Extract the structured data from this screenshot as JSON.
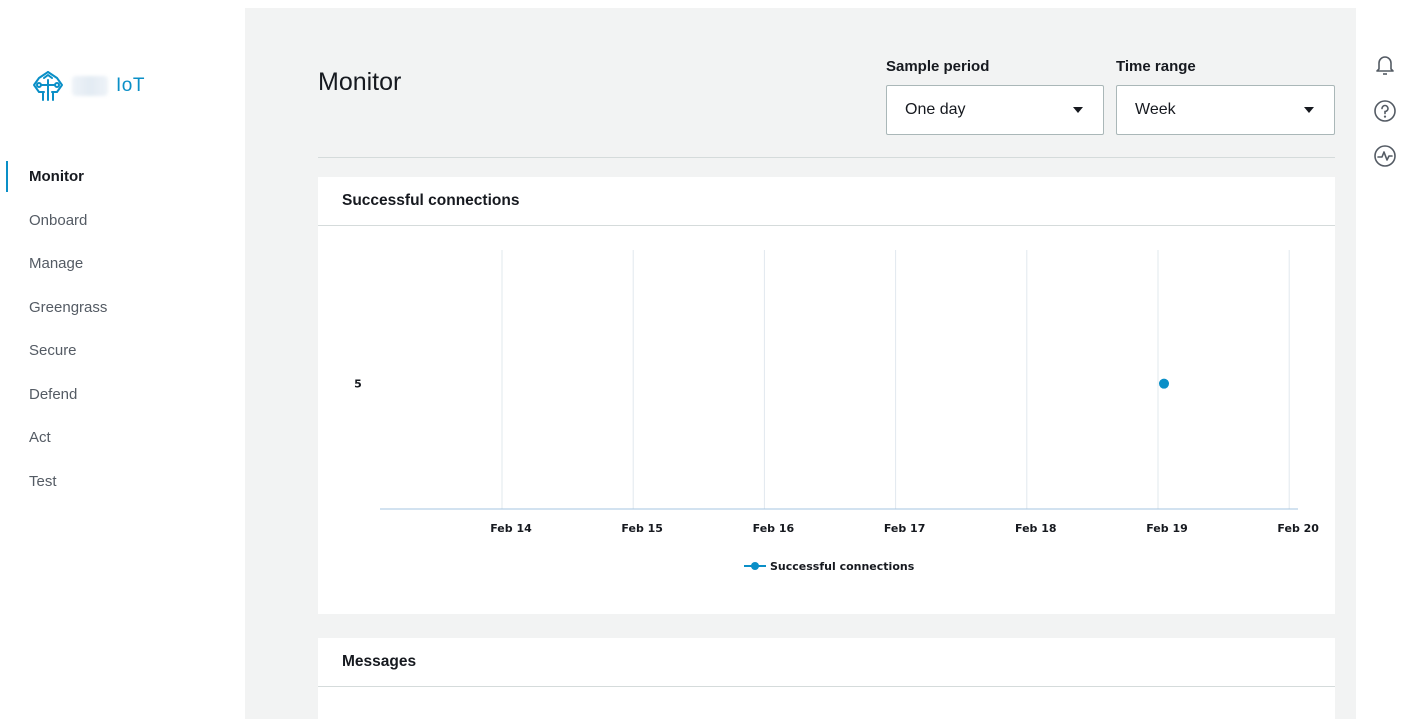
{
  "brand": {
    "name": "IoT"
  },
  "nav": {
    "items": [
      {
        "label": "Monitor",
        "active": true
      },
      {
        "label": "Onboard",
        "active": false
      },
      {
        "label": "Manage",
        "active": false
      },
      {
        "label": "Greengrass",
        "active": false
      },
      {
        "label": "Secure",
        "active": false
      },
      {
        "label": "Defend",
        "active": false
      },
      {
        "label": "Act",
        "active": false
      },
      {
        "label": "Test",
        "active": false
      }
    ]
  },
  "page": {
    "title": "Monitor"
  },
  "controls": {
    "sample_period": {
      "label": "Sample period",
      "value": "One day"
    },
    "time_range": {
      "label": "Time range",
      "value": "Week"
    }
  },
  "panels": {
    "connections": {
      "title": "Successful connections"
    },
    "messages": {
      "title": "Messages"
    }
  },
  "icons": {
    "notifications": "bell-icon",
    "help": "help-icon",
    "health": "pulse-icon"
  },
  "colors": {
    "accent": "#0a8fc7",
    "series": "#0a8fc7",
    "background": "#f2f3f3",
    "gridline": "#e1e8ee",
    "axis": "#a6c4e0"
  },
  "chart_data": {
    "type": "line",
    "x": [
      "Feb 14",
      "Feb 15",
      "Feb 16",
      "Feb 17",
      "Feb 18",
      "Feb 19",
      "Feb 20"
    ],
    "y_ticks": [
      5
    ],
    "series": [
      {
        "name": "Successful connections",
        "points": [
          {
            "x": "Feb 19",
            "y": 5
          }
        ]
      }
    ],
    "legend_position": "bottom-center",
    "grid": "vertical"
  }
}
